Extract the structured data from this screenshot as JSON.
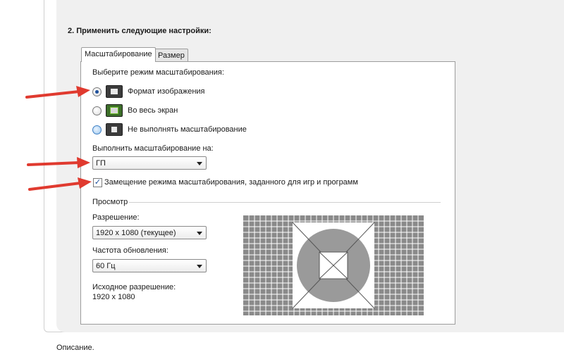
{
  "section_title": "2. Применить следующие настройки:",
  "tabs": [
    {
      "label": "Масштабирование",
      "active": true
    },
    {
      "label": "Размер",
      "active": false
    }
  ],
  "scaling_mode": {
    "prompt": "Выберите режим масштабирования:",
    "options": [
      {
        "label": "Формат изображения",
        "selected": true,
        "icon": "aspect-ratio-icon"
      },
      {
        "label": "Во весь экран",
        "selected": false,
        "icon": "fullscreen-icon"
      },
      {
        "label": "Не выполнять масштабирование",
        "selected": false,
        "icon": "no-scaling-icon"
      }
    ]
  },
  "perform_on": {
    "label": "Выполнить масштабирование на:",
    "value": "ГП"
  },
  "override": {
    "label": "Замещение режима масштабирования, заданного для игр и программ",
    "checked": true,
    "check_glyph": "✓"
  },
  "preview": {
    "group_label": "Просмотр",
    "resolution_label": "Разрешение:",
    "resolution_value": "1920 x 1080 (текущее)",
    "refresh_label": "Частота обновления:",
    "refresh_value": "60 Гц",
    "native_label": "Исходное разрешение:",
    "native_value": "1920 x 1080"
  },
  "description_label": "Описание.",
  "colors": {
    "arrow": "#e03a2f",
    "preview_grid": "#8a8a8a",
    "preview_bg": "#b0b0b0"
  }
}
